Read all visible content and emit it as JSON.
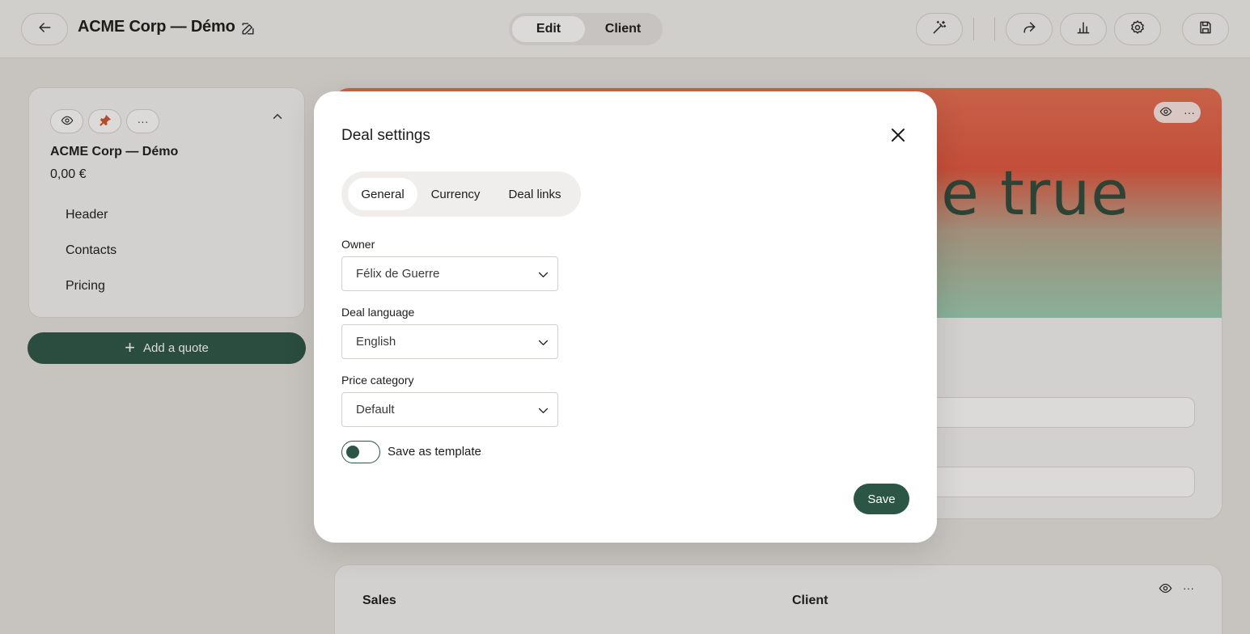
{
  "topbar": {
    "title": "ACME Corp — Démo",
    "mode_toggle": {
      "edit_label": "Edit",
      "client_label": "Client",
      "active": "Edit"
    },
    "icons": [
      "back-arrow-icon",
      "edit-pencil-icon",
      "magic-wand-icon",
      "share-icon",
      "analytics-icon",
      "gear-icon",
      "save-icon"
    ]
  },
  "left_panel": {
    "deal_name": "ACME Corp — Démo",
    "amount": "0,00 €",
    "more_label": "···",
    "sections": [
      "Header",
      "Contacts",
      "Pricing"
    ],
    "add_quote_label": "Add a quote"
  },
  "background": {
    "hero_text": "ne true",
    "more_label": "···",
    "sales_label": "Sales",
    "client_label": "Client"
  },
  "modal": {
    "title": "Deal settings",
    "tabs": [
      {
        "label": "General",
        "active": true
      },
      {
        "label": "Currency",
        "active": false
      },
      {
        "label": "Deal links",
        "active": false
      }
    ],
    "owner": {
      "label": "Owner",
      "value": "Félix de Guerre"
    },
    "deal_language": {
      "label": "Deal language",
      "value": "English"
    },
    "price_category": {
      "label": "Price category",
      "value": "Default"
    },
    "save_as_template": {
      "label": "Save as template",
      "on": false
    },
    "save_label": "Save"
  },
  "colors": {
    "accent": "#2b5646",
    "pin": "#d0532f",
    "background": "#e7e4e0"
  }
}
